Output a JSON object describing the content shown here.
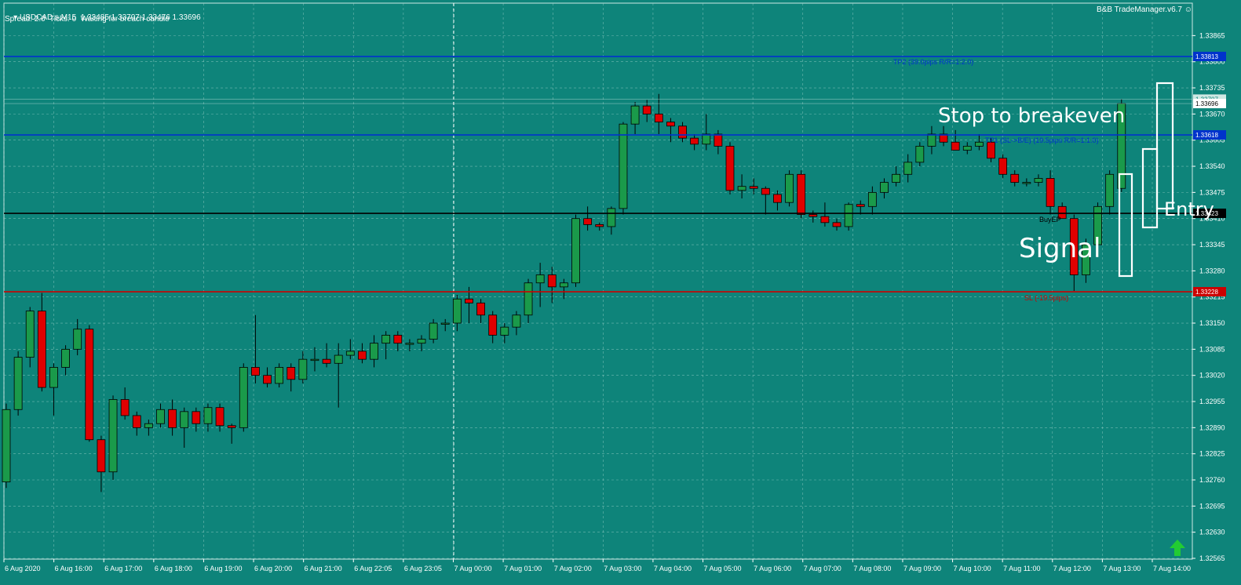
{
  "header": {
    "symbol": "USDCAD.s,M15",
    "ohlc": "1.33485 1.33707 1.33476 1.33696",
    "status": "Spread: 2.0  Ticks: 0  Waiting for breach candle",
    "brand": "B&B TradeManager.v6.7"
  },
  "colors": {
    "background": "#0e847a",
    "bull": "#1a9a4a",
    "bear": "#e00000",
    "grid": "#9ad0c8",
    "tp_line": "#0033cc",
    "sl_line": "#cc0000",
    "entry_line": "#000000"
  },
  "annotations": {
    "stop_to_breakeven": "Stop to breakeven",
    "signal": "Signal",
    "entry": "Entry"
  },
  "chart_data": {
    "type": "candlestick",
    "ylim": [
      1.32565,
      1.33895
    ],
    "y_ticks": [
      "1.33865",
      "1.33800",
      "1.33735",
      "1.33670",
      "1.33605",
      "1.33540",
      "1.33475",
      "1.33410",
      "1.33345",
      "1.33280",
      "1.33215",
      "1.33150",
      "1.33085",
      "1.33020",
      "1.32955",
      "1.32890",
      "1.32825",
      "1.32760",
      "1.32695",
      "1.32630",
      "1.32565"
    ],
    "x_ticks": [
      "6 Aug 2020",
      "6 Aug 16:00",
      "6 Aug 17:00",
      "6 Aug 18:00",
      "6 Aug 19:00",
      "6 Aug 20:00",
      "6 Aug 21:00",
      "6 Aug 22:05",
      "6 Aug 23:05",
      "7 Aug 00:00",
      "7 Aug 01:00",
      "7 Aug 02:00",
      "7 Aug 03:00",
      "7 Aug 04:00",
      "7 Aug 05:00",
      "7 Aug 06:00",
      "7 Aug 07:00",
      "7 Aug 08:00",
      "7 Aug 09:00",
      "7 Aug 10:00",
      "7 Aug 11:00",
      "7 Aug 12:00",
      "7 Aug 13:00",
      "7 Aug 14:00"
    ],
    "levels": [
      {
        "name": "tp2",
        "price": 1.33813,
        "price_label": "1.33813",
        "text": "TP2 (39.0pips R/R=1:2.0)",
        "color": "#0033cc"
      },
      {
        "name": "tp1",
        "price": 1.33618,
        "price_label": "1.33618",
        "text": "TP1 (SL->B/E) (19.5pips R/R=1:1.0)",
        "color": "#0033cc"
      },
      {
        "name": "entry",
        "price": 1.33423,
        "price_label": "1.33423",
        "text": "BuyEP",
        "color": "#000000"
      },
      {
        "name": "sl",
        "price": 1.33228,
        "price_label": "1.33228",
        "text": "SL (-19.5pips)",
        "color": "#cc0000"
      }
    ],
    "current_price_labels": [
      "1.33707",
      "1.33696"
    ],
    "candles": [
      [
        1.32755,
        1.3295,
        1.3274,
        1.32935
      ],
      [
        1.32935,
        1.3308,
        1.3292,
        1.33065
      ],
      [
        1.33065,
        1.3319,
        1.3304,
        1.3318
      ],
      [
        1.3318,
        1.33225,
        1.3298,
        1.3299
      ],
      [
        1.3299,
        1.3305,
        1.3292,
        1.3304
      ],
      [
        1.3304,
        1.33095,
        1.3302,
        1.33085
      ],
      [
        1.33085,
        1.3316,
        1.3307,
        1.33135
      ],
      [
        1.33135,
        1.33145,
        1.32855,
        1.3286
      ],
      [
        1.3286,
        1.3287,
        1.3273,
        1.3278
      ],
      [
        1.3278,
        1.3297,
        1.3276,
        1.3296
      ],
      [
        1.3296,
        1.3299,
        1.3291,
        1.3292
      ],
      [
        1.3292,
        1.3293,
        1.3287,
        1.3289
      ],
      [
        1.3289,
        1.3291,
        1.3287,
        1.329
      ],
      [
        1.329,
        1.3295,
        1.3289,
        1.32935
      ],
      [
        1.32935,
        1.3296,
        1.3287,
        1.3289
      ],
      [
        1.3289,
        1.3294,
        1.3284,
        1.3293
      ],
      [
        1.3293,
        1.3294,
        1.3288,
        1.329
      ],
      [
        1.329,
        1.3295,
        1.3288,
        1.3294
      ],
      [
        1.3294,
        1.3295,
        1.3288,
        1.32895
      ],
      [
        1.32895,
        1.329,
        1.3285,
        1.3289
      ],
      [
        1.3289,
        1.3305,
        1.3288,
        1.3304
      ],
      [
        1.3304,
        1.3317,
        1.33,
        1.3302
      ],
      [
        1.3302,
        1.3304,
        1.3299,
        1.33
      ],
      [
        1.33,
        1.3305,
        1.3299,
        1.3304
      ],
      [
        1.3304,
        1.3305,
        1.3298,
        1.3301
      ],
      [
        1.3301,
        1.3308,
        1.33,
        1.3306
      ],
      [
        1.3306,
        1.3309,
        1.3303,
        1.3306
      ],
      [
        1.3306,
        1.331,
        1.3304,
        1.3305
      ],
      [
        1.3305,
        1.331,
        1.3294,
        1.3307
      ],
      [
        1.3307,
        1.3311,
        1.3306,
        1.3308
      ],
      [
        1.3308,
        1.331,
        1.3305,
        1.3306
      ],
      [
        1.3306,
        1.3312,
        1.3304,
        1.331
      ],
      [
        1.331,
        1.3313,
        1.3306,
        1.3312
      ],
      [
        1.3312,
        1.3313,
        1.3308,
        1.331
      ],
      [
        1.331,
        1.3311,
        1.3308,
        1.331
      ],
      [
        1.331,
        1.3312,
        1.3308,
        1.3311
      ],
      [
        1.3311,
        1.3316,
        1.331,
        1.3315
      ],
      [
        1.3315,
        1.3316,
        1.3313,
        1.3315
      ],
      [
        1.3315,
        1.3322,
        1.3313,
        1.3321
      ],
      [
        1.3321,
        1.3324,
        1.3315,
        1.332
      ],
      [
        1.332,
        1.3321,
        1.3315,
        1.3317
      ],
      [
        1.3317,
        1.3318,
        1.331,
        1.3312
      ],
      [
        1.3312,
        1.3315,
        1.331,
        1.3314
      ],
      [
        1.3314,
        1.3318,
        1.3312,
        1.3317
      ],
      [
        1.3317,
        1.3326,
        1.3315,
        1.3325
      ],
      [
        1.3325,
        1.333,
        1.3319,
        1.3327
      ],
      [
        1.3327,
        1.3329,
        1.332,
        1.3324
      ],
      [
        1.3324,
        1.3326,
        1.3321,
        1.3325
      ],
      [
        1.3325,
        1.3342,
        1.3324,
        1.3341
      ],
      [
        1.3341,
        1.3344,
        1.3338,
        1.33395
      ],
      [
        1.33395,
        1.334,
        1.3338,
        1.3339
      ],
      [
        1.3339,
        1.3344,
        1.3337,
        1.33435
      ],
      [
        1.33435,
        1.3365,
        1.3342,
        1.33645
      ],
      [
        1.33645,
        1.337,
        1.3362,
        1.3369
      ],
      [
        1.3369,
        1.33705,
        1.3365,
        1.3367
      ],
      [
        1.3367,
        1.3372,
        1.3362,
        1.3365
      ],
      [
        1.3365,
        1.3366,
        1.336,
        1.3364
      ],
      [
        1.3364,
        1.3365,
        1.336,
        1.3361
      ],
      [
        1.3361,
        1.3362,
        1.3358,
        1.33595
      ],
      [
        1.33595,
        1.3367,
        1.3358,
        1.3362
      ],
      [
        1.3362,
        1.3363,
        1.3357,
        1.3359
      ],
      [
        1.3359,
        1.336,
        1.3347,
        1.3348
      ],
      [
        1.3348,
        1.3352,
        1.3346,
        1.3349
      ],
      [
        1.3349,
        1.3351,
        1.3347,
        1.33485
      ],
      [
        1.33485,
        1.3349,
        1.3342,
        1.3347
      ],
      [
        1.3347,
        1.3348,
        1.3343,
        1.3345
      ],
      [
        1.3345,
        1.3353,
        1.3344,
        1.3352
      ],
      [
        1.3352,
        1.3353,
        1.3341,
        1.3342
      ],
      [
        1.3342,
        1.3343,
        1.334,
        1.33415
      ],
      [
        1.33415,
        1.3345,
        1.3339,
        1.334
      ],
      [
        1.334,
        1.3341,
        1.3338,
        1.3339
      ],
      [
        1.3339,
        1.3345,
        1.3338,
        1.33445
      ],
      [
        1.33445,
        1.33455,
        1.3342,
        1.3344
      ],
      [
        1.3344,
        1.3349,
        1.3342,
        1.33475
      ],
      [
        1.33475,
        1.3351,
        1.3346,
        1.335
      ],
      [
        1.335,
        1.3354,
        1.3349,
        1.3352
      ],
      [
        1.3352,
        1.3357,
        1.335,
        1.3355
      ],
      [
        1.3355,
        1.336,
        1.3354,
        1.3359
      ],
      [
        1.3359,
        1.3364,
        1.3357,
        1.3362
      ],
      [
        1.3362,
        1.3364,
        1.3359,
        1.336
      ],
      [
        1.336,
        1.3363,
        1.3358,
        1.3358
      ],
      [
        1.3358,
        1.336,
        1.3357,
        1.3359
      ],
      [
        1.3359,
        1.3362,
        1.3358,
        1.336
      ],
      [
        1.336,
        1.3361,
        1.3355,
        1.3356
      ],
      [
        1.3356,
        1.3357,
        1.3351,
        1.3352
      ],
      [
        1.3352,
        1.3353,
        1.3349,
        1.335
      ],
      [
        1.335,
        1.3351,
        1.3349,
        1.335
      ],
      [
        1.335,
        1.3352,
        1.3349,
        1.3351
      ],
      [
        1.3351,
        1.3353,
        1.3342,
        1.3344
      ],
      [
        1.3344,
        1.3345,
        1.3341,
        1.3341
      ],
      [
        1.3341,
        1.3342,
        1.3323,
        1.3327
      ],
      [
        1.3327,
        1.3336,
        1.3325,
        1.33345
      ],
      [
        1.33345,
        1.3345,
        1.3332,
        1.3344
      ],
      [
        1.3344,
        1.3353,
        1.3342,
        1.3352
      ],
      [
        1.33485,
        1.33707,
        1.33476,
        1.33696
      ]
    ]
  }
}
